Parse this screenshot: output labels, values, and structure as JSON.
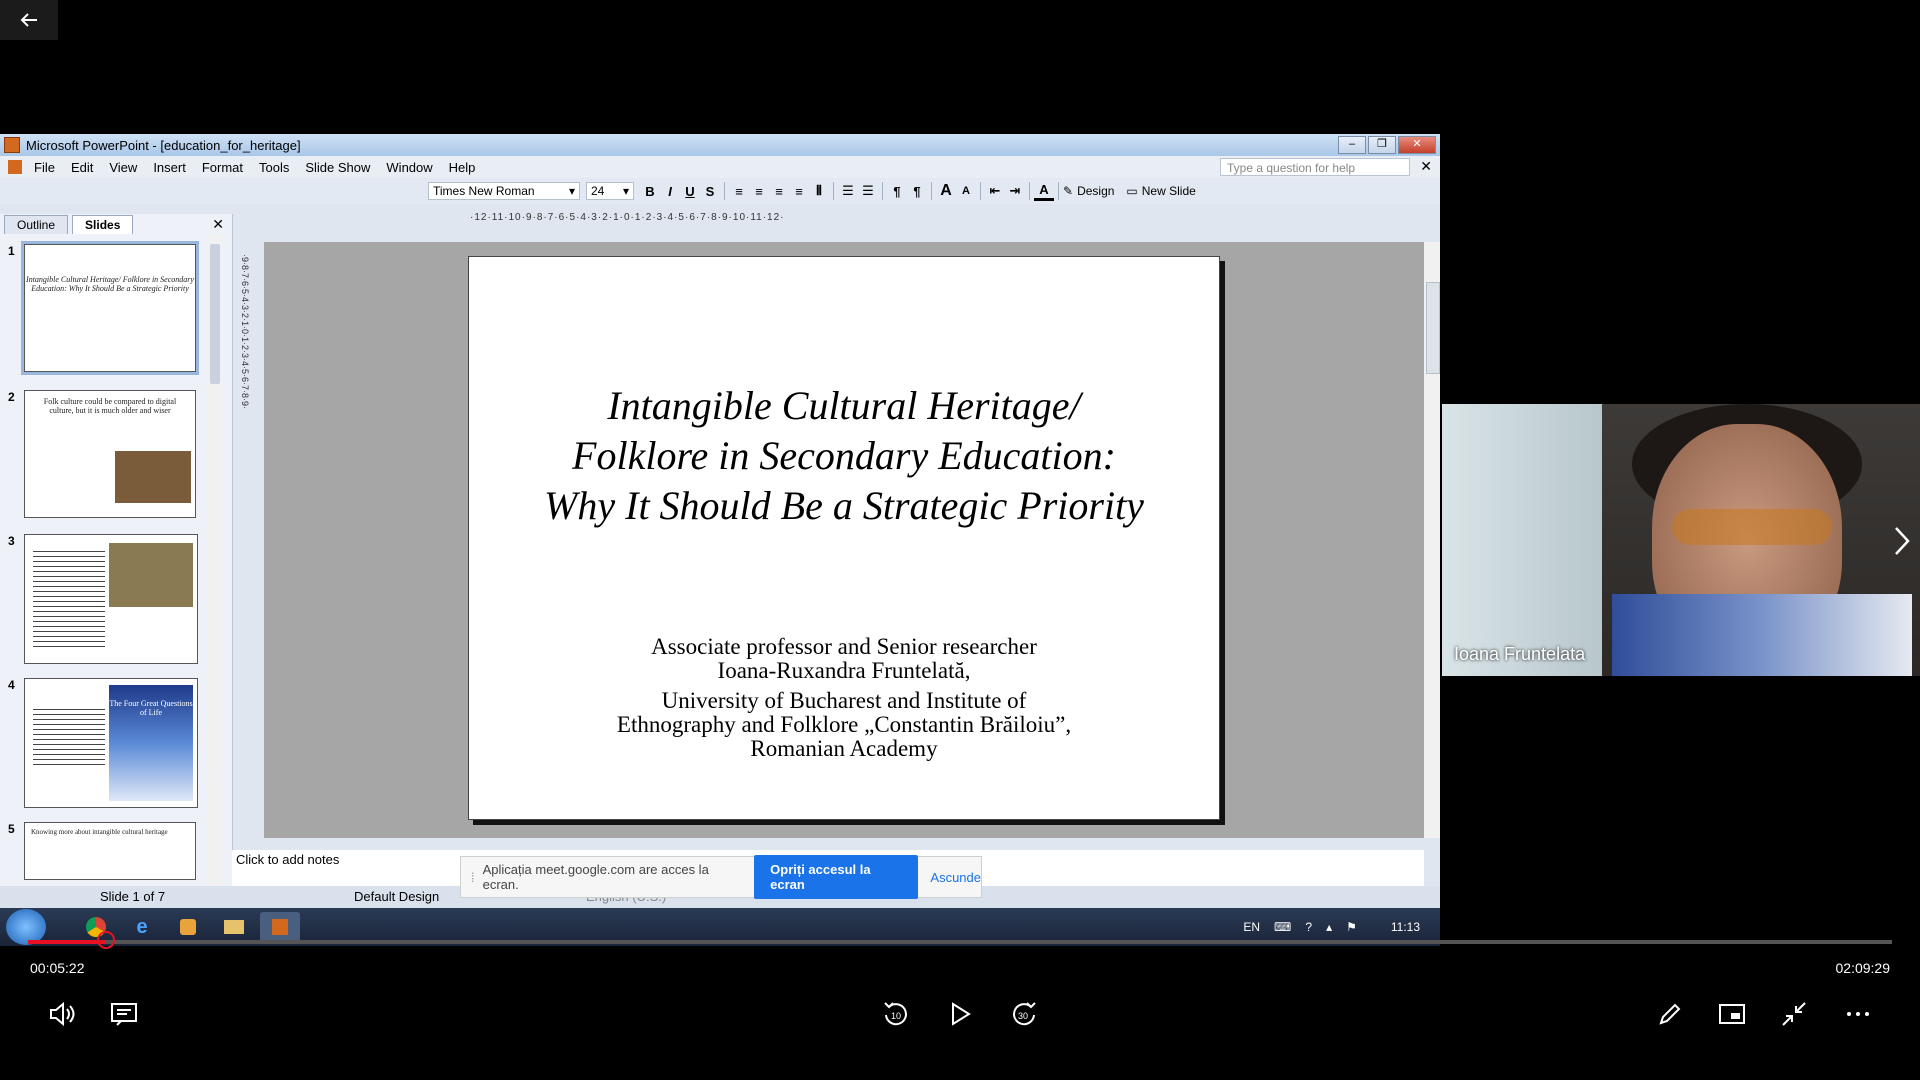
{
  "powerpoint": {
    "window_title": "Microsoft PowerPoint - [education_for_heritage]",
    "menu": [
      "File",
      "Edit",
      "View",
      "Insert",
      "Format",
      "Tools",
      "Slide Show",
      "Window",
      "Help"
    ],
    "help_placeholder": "Type a question for help",
    "font_name": "Times New Roman",
    "font_size": "24",
    "design_label": "Design",
    "new_slide_label": "New Slide",
    "ruler_h": "·12·11·10·9·8·7·6·5·4·3·2·1·0·1·2·3·4·5·6·7·8·9·10·11·12·",
    "ruler_v": "·9·8·7·6·5·4·3·2·1·0·1·2·3·4·5·6·7·8·9·",
    "pane_tabs": [
      "Outline",
      "Slides"
    ],
    "thumbnails": [
      {
        "num": "1",
        "text": "Intangible Cultural Heritage/ Folklore in Secondary Education: Why It Should Be a Strategic Priority"
      },
      {
        "num": "2",
        "text": "Folk culture could be compared to digital culture, but it is much older and wiser"
      },
      {
        "num": "3",
        "text": ""
      },
      {
        "num": "4",
        "text": "The Four Great Questions of Life"
      },
      {
        "num": "5",
        "text": "Knowing more about intangible cultural heritage"
      }
    ],
    "slide": {
      "title_lines": [
        "Intangible Cultural Heritage/",
        "Folklore in Secondary Education:",
        "Why It Should Be a Strategic Priority"
      ],
      "subtitle_lines": [
        "Associate professor and Senior researcher",
        "Ioana-Ruxandra Fruntelată,",
        "University of Bucharest and Institute of",
        "Ethnography and Folklore „Constantin Brăiloiu”,",
        "Romanian Academy"
      ]
    },
    "notes_placeholder": "Click to add notes",
    "status": {
      "slide_count": "Slide 1 of 7",
      "design": "Default Design",
      "language": "English (U.S.)"
    }
  },
  "share_banner": {
    "message": "Aplicația meet.google.com are acces la ecran.",
    "stop_label": "Opriți accesul la ecran",
    "hide_label": "Ascunde"
  },
  "taskbar": {
    "lang": "EN",
    "clock": "11:13"
  },
  "video": {
    "participant_name": "Ioana Fruntelata"
  },
  "player": {
    "current_time": "00:05:22",
    "total_time": "02:09:29",
    "progress": 0.0416
  },
  "colors": {
    "accent": "#e81123",
    "meet_blue": "#1a73e8"
  }
}
